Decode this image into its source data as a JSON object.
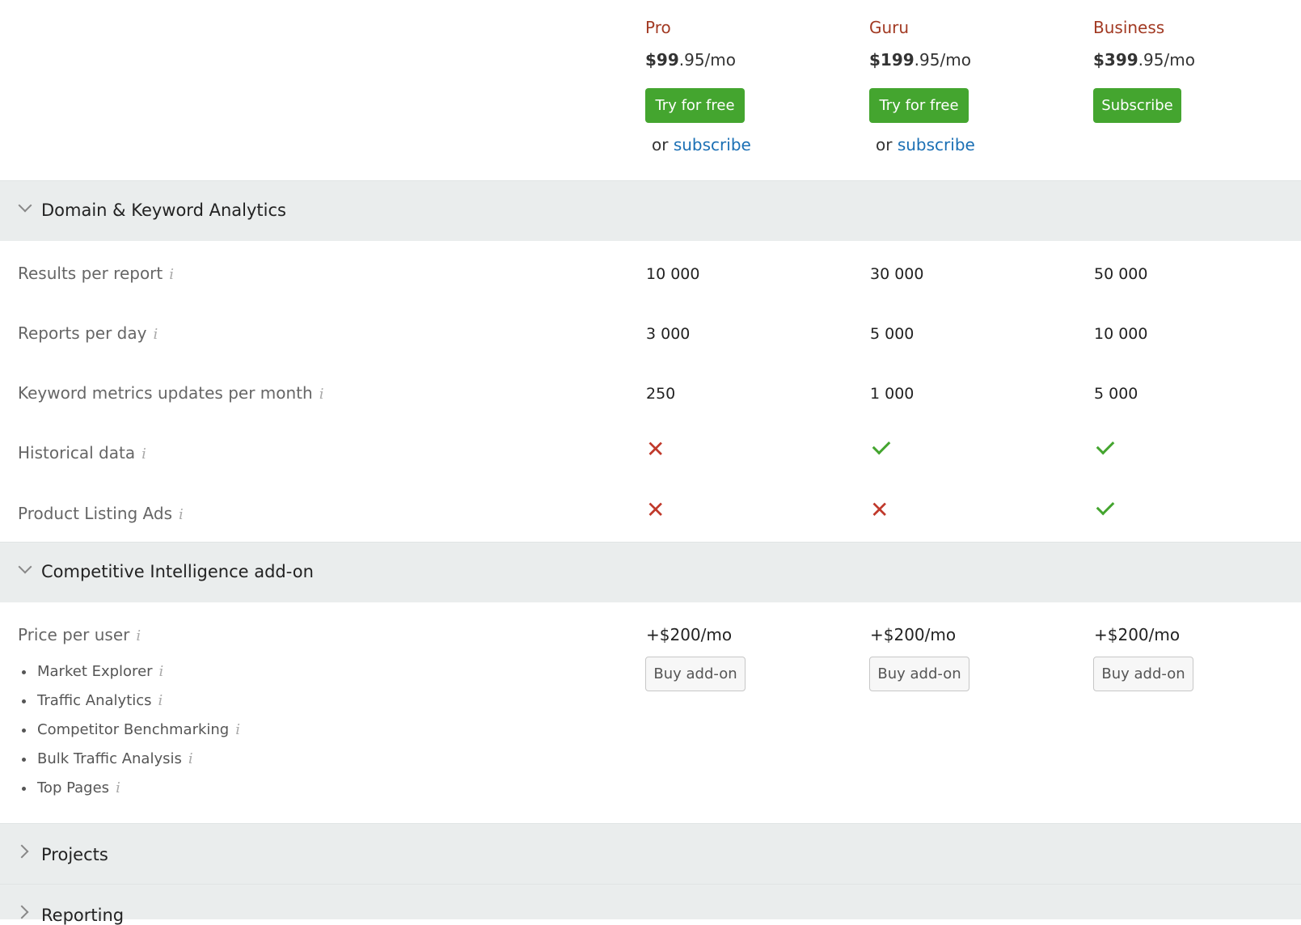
{
  "plans": [
    {
      "name": "Pro",
      "price_main": "$99",
      "price_rest": ".95/mo",
      "primary_button": "Try for free",
      "or_text": "or",
      "subscribe_link": "subscribe"
    },
    {
      "name": "Guru",
      "price_main": "$199",
      "price_rest": ".95/mo",
      "primary_button": "Try for free",
      "or_text": "or",
      "subscribe_link": "subscribe"
    },
    {
      "name": "Business",
      "price_main": "$399",
      "price_rest": ".95/mo",
      "primary_button": "Subscribe"
    }
  ],
  "sections": [
    {
      "title": "Domain & Keyword Analytics",
      "expanded": true
    },
    {
      "title": "Competitive Intelligence add-on",
      "expanded": true
    },
    {
      "title": "Projects",
      "expanded": false
    },
    {
      "title": "Reporting",
      "expanded": false
    }
  ],
  "domain_rows": [
    {
      "label": "Results per report",
      "values": [
        "10 000",
        "30 000",
        "50 000"
      ]
    },
    {
      "label": "Reports per day",
      "values": [
        "3 000",
        "5 000",
        "10 000"
      ]
    },
    {
      "label": "Keyword metrics updates per month",
      "values": [
        "250",
        "1 000",
        "5 000"
      ]
    },
    {
      "label": "Historical data",
      "values": [
        "cross",
        "check",
        "check"
      ]
    },
    {
      "label": "Product Listing Ads",
      "values": [
        "cross",
        "cross",
        "check"
      ]
    }
  ],
  "addon": {
    "label": "Price per user",
    "prices": [
      "+$200/mo",
      "+$200/mo",
      "+$200/mo"
    ],
    "button": "Buy add-on",
    "features": [
      "Market Explorer",
      "Traffic Analytics",
      "Competitor Benchmarking",
      "Bulk Traffic Analysis",
      "Top Pages"
    ]
  },
  "colors": {
    "accent_green": "#44a52f",
    "plan_name": "#a23a23",
    "link": "#1a6fb4",
    "cross": "#c0392b",
    "section_bg": "#eaeded"
  }
}
